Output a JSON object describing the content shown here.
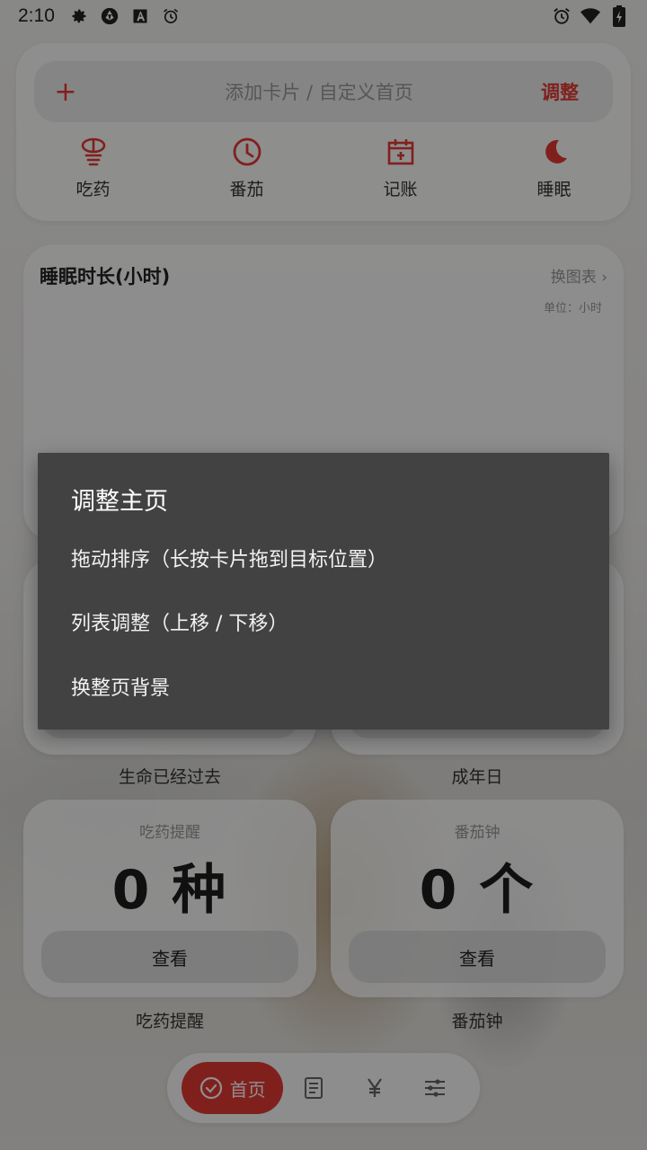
{
  "status_bar": {
    "time": "2:10",
    "left_icons": [
      "gear-icon",
      "aperture-icon",
      "font-a-icon",
      "alarm-icon"
    ],
    "right_icons": [
      "alarm-icon",
      "wifi-icon",
      "battery-charging-icon"
    ]
  },
  "quick_card": {
    "add_text": "添加卡片 / 自定义首页",
    "adjust_label": "调整",
    "shortcuts": [
      {
        "label": "吃药",
        "icon": "pill-icon"
      },
      {
        "label": "番茄",
        "icon": "clock-icon"
      },
      {
        "label": "记账",
        "icon": "ledger-icon"
      },
      {
        "label": "睡眠",
        "icon": "moon-icon"
      }
    ]
  },
  "sleep_card": {
    "title": "睡眠时长(小时)",
    "switch_label": "换图表",
    "unit": "单位：小时"
  },
  "middle_cards": {
    "left_caption": "生命已经过去",
    "right_caption": "成年日"
  },
  "bottom_cards": [
    {
      "title": "吃药提醒",
      "value": "0 种",
      "button": "查看",
      "caption": "吃药提醒"
    },
    {
      "title": "番茄钟",
      "value": "0 个",
      "button": "查看",
      "caption": "番茄钟"
    }
  ],
  "bottom_nav": {
    "home_label": "首页",
    "items": [
      "document-icon",
      "yen-icon",
      "sliders-icon"
    ]
  },
  "dialog": {
    "title": "调整主页",
    "items": [
      "拖动排序（长按卡片拖到目标位置）",
      "列表调整（上移 / 下移）",
      "换整页背景"
    ]
  },
  "colors": {
    "accent": "#e53935",
    "dialog_bg": "#424242"
  }
}
